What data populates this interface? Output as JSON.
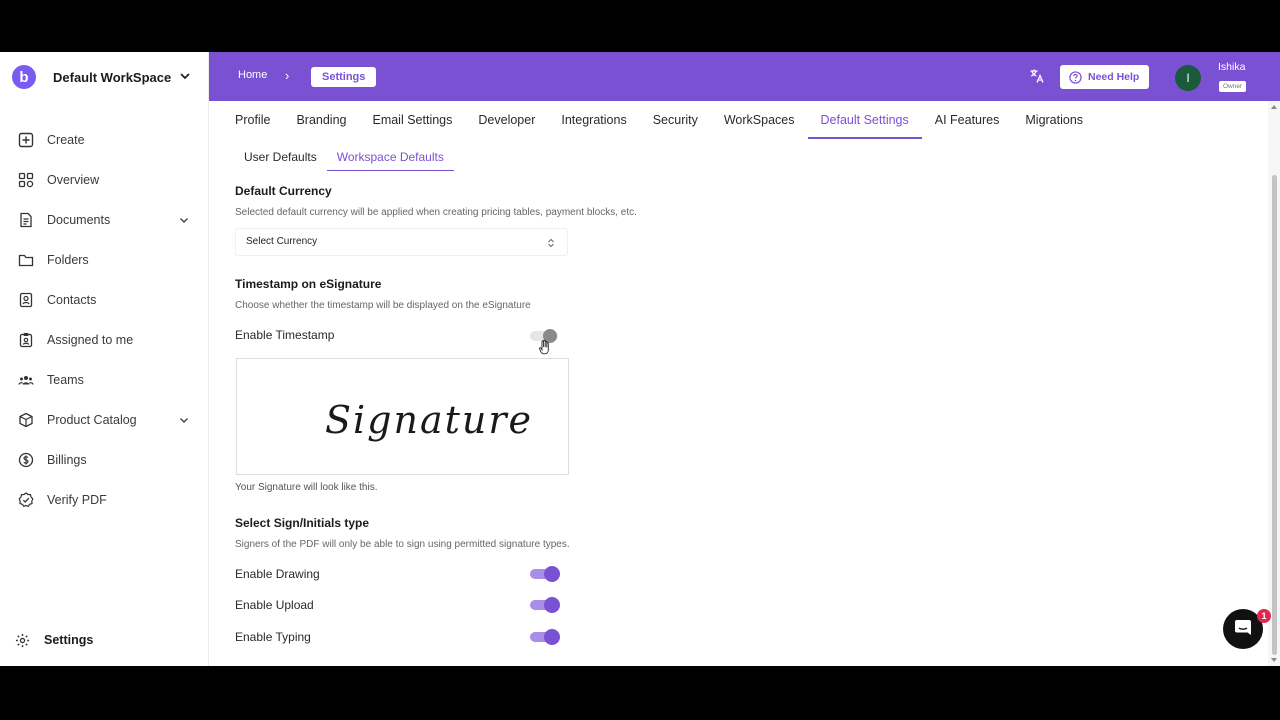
{
  "workspace": {
    "name": "Default WorkSpace",
    "logo_letter": "b"
  },
  "sidebar": {
    "items": [
      {
        "label": "Create",
        "icon": "plus-square-icon"
      },
      {
        "label": "Overview",
        "icon": "overview-grid-icon"
      },
      {
        "label": "Documents",
        "icon": "document-icon",
        "expandable": true
      },
      {
        "label": "Folders",
        "icon": "folder-icon"
      },
      {
        "label": "Contacts",
        "icon": "contacts-icon"
      },
      {
        "label": "Assigned to me",
        "icon": "assigned-icon"
      },
      {
        "label": "Teams",
        "icon": "teams-icon"
      },
      {
        "label": "Product Catalog",
        "icon": "product-box-icon",
        "expandable": true
      },
      {
        "label": "Billings",
        "icon": "dollar-icon"
      },
      {
        "label": "Verify PDF",
        "icon": "verify-badge-icon"
      }
    ],
    "settings_label": "Settings"
  },
  "header": {
    "breadcrumb_home": "Home",
    "breadcrumb_current": "Settings",
    "help_label": "Need Help",
    "user_initial": "I",
    "user_name": "Ishika",
    "user_role": "Owner"
  },
  "tabs": [
    "Profile",
    "Branding",
    "Email Settings",
    "Developer",
    "Integrations",
    "Security",
    "WorkSpaces",
    "Default Settings",
    "AI Features",
    "Migrations"
  ],
  "active_tab": "Default Settings",
  "subtabs": [
    "User Defaults",
    "Workspace Defaults"
  ],
  "active_subtab": "Workspace Defaults",
  "currency": {
    "title": "Default Currency",
    "desc": "Selected default currency will be applied when creating pricing tables, payment blocks, etc.",
    "placeholder": "Select Currency"
  },
  "timestamp": {
    "title": "Timestamp on eSignature",
    "desc": "Choose whether the timestamp will be displayed on the eSignature",
    "toggle_label": "Enable Timestamp",
    "enabled": false,
    "signature_text": "Signature",
    "caption": "Your Signature will look like this."
  },
  "sign_types": {
    "title": "Select Sign/Initials type",
    "desc": "Signers of the PDF will only be able to sign using permitted signature types.",
    "options": [
      {
        "label": "Enable Drawing",
        "enabled": true
      },
      {
        "label": "Enable Upload",
        "enabled": true
      },
      {
        "label": "Enable Typing",
        "enabled": true
      }
    ]
  },
  "chat": {
    "badge": "1"
  },
  "colors": {
    "brand": "#7b51d4",
    "toggle_on": "#7b51d4",
    "toggle_track": "#a98de8",
    "badge": "#e0284e"
  }
}
